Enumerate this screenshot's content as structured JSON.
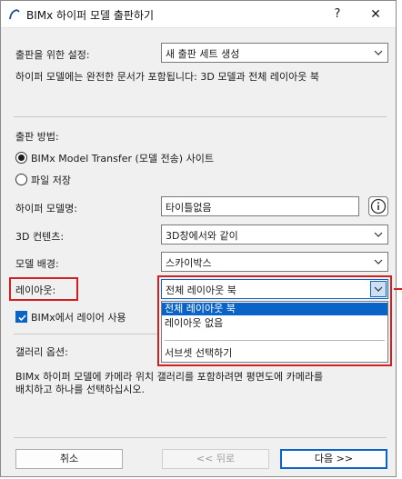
{
  "window": {
    "title": "BIMx 하이퍼 모델 출판하기",
    "help_label": "?",
    "close_label": "✕"
  },
  "publish_settings": {
    "label": "출판을 위한 설정:",
    "value": "새 출판 세트 생성",
    "description": "하이퍼 모델에는 완전한 문서가 포함됩니다: 3D 모델과 전체 레이아웃 북"
  },
  "publish_method": {
    "label": "출판 방법:",
    "options": [
      {
        "label": "BIMx Model Transfer (모델 전송) 사이트",
        "selected": true
      },
      {
        "label": "파일 저장",
        "selected": false
      }
    ]
  },
  "hypermodel_name": {
    "label": "하이퍼 모델명:",
    "value": "타이틀없음"
  },
  "content_3d": {
    "label": "3D 컨텐츠:",
    "value": "3D창에서와 같이"
  },
  "model_background": {
    "label": "모델 배경:",
    "value": "스카이박스"
  },
  "layout": {
    "label": "레이아웃:",
    "value": "전체 레이아웃 북",
    "options": [
      "전체 레이아웃 북",
      "레이아웃 없음",
      "서브셋 선택하기"
    ],
    "selected_index": 0
  },
  "use_layers": {
    "label": "BIMx에서 레이어 사용",
    "checked": true
  },
  "gallery": {
    "label": "갤러리 옵션:",
    "description_line1": "BIMx 하이퍼 모델에 카메라 위치 갤러리를 포함하려면 평면도에 카메라를",
    "description_line2": "배치하고 하나를 선택하십시오."
  },
  "buttons": {
    "cancel": "취소",
    "back": "<< 뒤로",
    "next": "다음 >>"
  },
  "colors": {
    "accent": "#0a64c8",
    "highlight_box": "#d21f1f"
  },
  "icons": [
    "bimx-app-icon",
    "chevron-down-icon",
    "info-icon",
    "checkmark-icon"
  ]
}
